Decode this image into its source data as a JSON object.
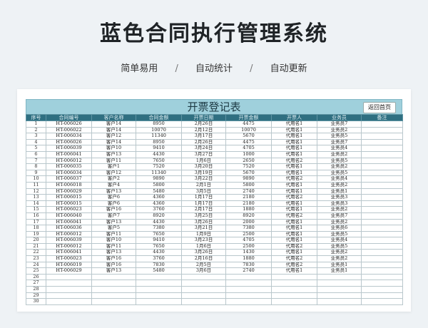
{
  "header": {
    "title": "蓝色合同执行管理系统",
    "tags": [
      "简单易用",
      "自动统计",
      "自动更新"
    ],
    "separator": "/"
  },
  "sheet": {
    "title": "开票登记表",
    "home_button": "返回首页",
    "columns": [
      "序号",
      "合同编号",
      "客户名称",
      "合同金额",
      "开票日期",
      "开票金额",
      "开票人",
      "业务员",
      "备注"
    ],
    "rows": [
      [
        "1",
        "HT-006026",
        "客户14",
        "8950",
        "2月26日",
        "4475",
        "代用名1",
        "业务员7",
        ""
      ],
      [
        "2",
        "HT-006022",
        "客户14",
        "10070",
        "2月12日",
        "10070",
        "代用名1",
        "业务员2",
        ""
      ],
      [
        "3",
        "HT-006034",
        "客户12",
        "11340",
        "3月17日",
        "5670",
        "代用名1",
        "业务员5",
        ""
      ],
      [
        "4",
        "HT-006026",
        "客户14",
        "8950",
        "2月26日",
        "4475",
        "代用名1",
        "业务员7",
        ""
      ],
      [
        "5",
        "HT-006039",
        "客户10",
        "9410",
        "3月24日",
        "4705",
        "代用名1",
        "业务员4",
        ""
      ],
      [
        "6",
        "HT-006041",
        "客户13",
        "4430",
        "3月27日",
        "1000",
        "代用名1",
        "业务员2",
        ""
      ],
      [
        "7",
        "HT-006012",
        "客户11",
        "7650",
        "1月6日",
        "2650",
        "代用名2",
        "业务员5",
        ""
      ],
      [
        "8",
        "HT-006035",
        "客户1",
        "7520",
        "3月20日",
        "7520",
        "代用名1",
        "业务员2",
        ""
      ],
      [
        "9",
        "HT-006034",
        "客户12",
        "11340",
        "3月19日",
        "5670",
        "代用名1",
        "业务员5",
        ""
      ],
      [
        "10",
        "HT-006037",
        "客户2",
        "9890",
        "3月22日",
        "9890",
        "代用名2",
        "业务员4",
        ""
      ],
      [
        "11",
        "HT-006018",
        "客户4",
        "5800",
        "2月1日",
        "5800",
        "代用名1",
        "业务员2",
        ""
      ],
      [
        "12",
        "HT-006029",
        "客户13",
        "5480",
        "3月5日",
        "2740",
        "代用名1",
        "业务员1",
        ""
      ],
      [
        "13",
        "HT-006015",
        "客户6",
        "4360",
        "1月17日",
        "2180",
        "代用名2",
        "业务员3",
        ""
      ],
      [
        "14",
        "HT-006015",
        "客户6",
        "4360",
        "1月17日",
        "2180",
        "代用名1",
        "业务员3",
        ""
      ],
      [
        "15",
        "HT-006023",
        "客户16",
        "3760",
        "2月17日",
        "1880",
        "代用名1",
        "业务员2",
        ""
      ],
      [
        "16",
        "HT-006040",
        "客户7",
        "8920",
        "3月25日",
        "8920",
        "代用名2",
        "业务员7",
        ""
      ],
      [
        "17",
        "HT-006041",
        "客户13",
        "4430",
        "3月26日",
        "2000",
        "代用名1",
        "业务员2",
        ""
      ],
      [
        "18",
        "HT-006036",
        "客户5",
        "7380",
        "3月21日",
        "7380",
        "代用名1",
        "业务员6",
        ""
      ],
      [
        "19",
        "HT-006012",
        "客户11",
        "7650",
        "1月9日",
        "2500",
        "代用名1",
        "业务员5",
        ""
      ],
      [
        "20",
        "HT-006039",
        "客户10",
        "9410",
        "3月23日",
        "4705",
        "代用名1",
        "业务员4",
        ""
      ],
      [
        "21",
        "HT-006012",
        "客户11",
        "7650",
        "1月6日",
        "2500",
        "代用名2",
        "业务员5",
        ""
      ],
      [
        "22",
        "HT-006041",
        "客户13",
        "4430",
        "3月26日",
        "1430",
        "代用名1",
        "业务员2",
        ""
      ],
      [
        "23",
        "HT-006023",
        "客户16",
        "3760",
        "2月16日",
        "1880",
        "代用名2",
        "业务员2",
        ""
      ],
      [
        "24",
        "HT-006019",
        "客户16",
        "7830",
        "2月5日",
        "7830",
        "代用名2",
        "业务员1",
        ""
      ],
      [
        "25",
        "HT-006029",
        "客户13",
        "5480",
        "3月6日",
        "2740",
        "代用名1",
        "业务员1",
        ""
      ],
      [
        "26",
        "",
        "",
        "",
        "",
        "",
        "",
        "",
        ""
      ],
      [
        "27",
        "",
        "",
        "",
        "",
        "",
        "",
        "",
        ""
      ],
      [
        "28",
        "",
        "",
        "",
        "",
        "",
        "",
        "",
        ""
      ],
      [
        "29",
        "",
        "",
        "",
        "",
        "",
        "",
        "",
        ""
      ],
      [
        "30",
        "",
        "",
        "",
        "",
        "",
        "",
        "",
        ""
      ]
    ]
  }
}
